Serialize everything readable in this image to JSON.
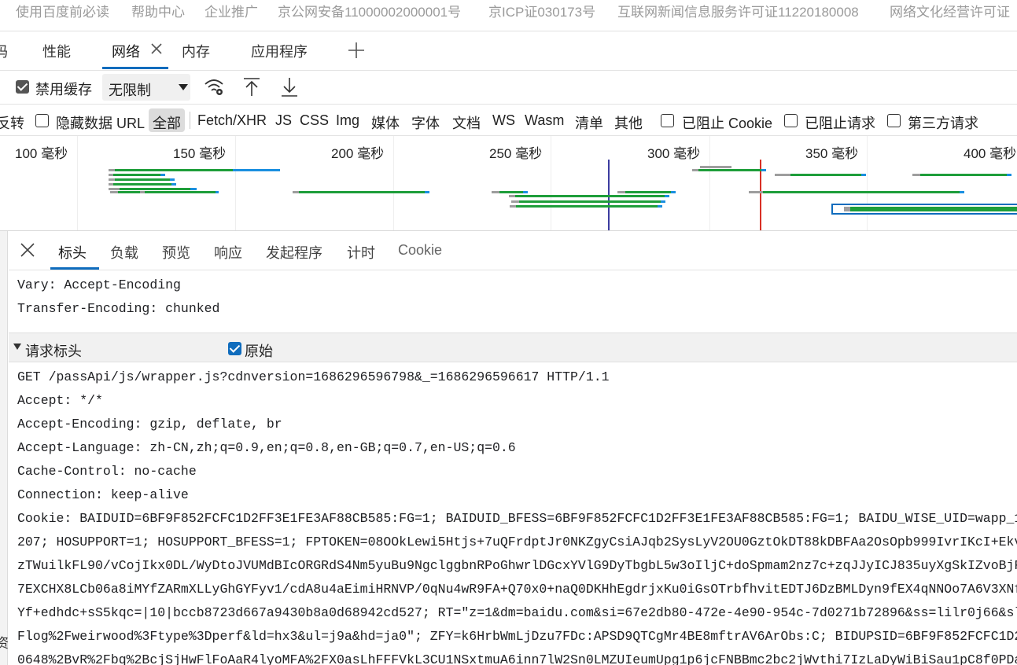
{
  "page_footer": {
    "links": [
      "使用百度前必读",
      "帮助中心",
      "企业推广",
      "京公网安备11000002000001号",
      "京ICP证030173号",
      "互联网新闻信息服务许可证11220180008",
      "网络文化经营许可证"
    ]
  },
  "tabs": {
    "items": [
      "码",
      "性能",
      "网络",
      "内存",
      "应用程序"
    ],
    "active": "网络"
  },
  "toolbar": {
    "disable_cache_label": "禁用缓存",
    "disable_cache_checked": true,
    "throttle_value": "无限制"
  },
  "filters": {
    "invert_label": "反转",
    "hide_data_urls_label": "隐藏数据 URL",
    "types": [
      "全部",
      "Fetch/XHR",
      "JS",
      "CSS",
      "Img",
      "媒体",
      "字体",
      "文档",
      "WS",
      "Wasm",
      "清单",
      "其他"
    ],
    "blocked_cookies_label": "已阻止 Cookie",
    "blocked_requests_label": "已阻止请求",
    "third_party_label": "第三方请求"
  },
  "timeline": {
    "labels": [
      "100  毫秒",
      "150  毫秒",
      "200  毫秒",
      "250  毫秒",
      "300  毫秒",
      "350  毫秒",
      "400  毫秒"
    ]
  },
  "detail": {
    "tabs": [
      "标头",
      "负载",
      "预览",
      "响应",
      "发起程序",
      "计时",
      "Cookie"
    ],
    "active": "标头",
    "response_headers": [
      "Vary: Accept-Encoding",
      "Transfer-Encoding: chunked"
    ],
    "request_section_title": "请求标头",
    "raw_label": "原始",
    "raw_checked": true,
    "request_lines": [
      "GET /passApi/js/wrapper.js?cdnversion=1686296596798&_=1686296596617 HTTP/1.1",
      "Accept: */*",
      "Accept-Encoding: gzip, deflate, br",
      "Accept-Language: zh-CN,zh;q=0.9,en;q=0.8,en-GB;q=0.7,en-US;q=0.6",
      "Cache-Control: no-cache",
      "Connection: keep-alive"
    ],
    "cookie_lines": [
      "Cookie: BAIDUID=6BF9F852FCFC1D2FF3E1FE3AF88CB585:FG=1; BAIDUID_BFESS=6BF9F852FCFC1D2FF3E1FE3AF88CB585:FG=1; BAIDU_WISE_UID=wapp_1",
      "207; HOSUPPORT=1; HOSUPPORT_BFESS=1; FPTOKEN=08OOkLewi5Htjs+7uQFrdptJr0NKZgyCsiAJqb2SysLyV2OU0GztOkDT88kDBFAa2OsOpb999IvrIKcI+Ekv",
      "zTWuilkFL90/vCojIkx0DL/WyDtoJVUMdBIcORGRdS4Nm5yuBu9NgclggbnRPoGhwrlDGcxYVlG9DyTbgbL5w3oIljC+doSpmam2nz7c+zqJJyICJ835uyXgSkIZvoBjF",
      "7EXCHX8LCb06a8iMYfZARmXLLyGhGYFyv1/cdA8u4aEimiHRNVP/0qNu4wR9FA+Q70x0+naQ0DKHhEgdrjxKu0iGsOTrbfhvitEDTJ6DzBMLDyn9fEX4qNNOo7A6V3XNf",
      "Yf+edhdc+sS5kqc=|10|bccb8723d667a9430b8a0d68942cd527; RT=\"z=1&dm=baidu.com&si=67e2db80-472e-4e90-954c-7d0271b72896&ss=lilr0j66&sl",
      "Flog%2Fweirwood%3Ftype%3Dperf&ld=hx3&ul=j9a&hd=ja0\"; ZFY=k6HrbWmLjDzu7FDc:APSD9QTCgMr4BE8mftrAV6ArObs:C; BIDUPSID=6BF9F852FCFC1D2",
      "0648%2BvR%2Fbq%2BcjSjHwFlFoAaR4lyoMFA%2FX0asLhFFFVkL3CU1NSxtmuA6inn7lW2Sn0LMZUIeumUpg1p6jcFNBBmc2bc2jWvthi7IzLaDyWiBiSau1pC8f0PDa"
    ],
    "gutter_glyph": "资"
  },
  "colors": {
    "accent": "#0f6cbd",
    "waterfall_green": "#1e9e3a",
    "waterfall_blue": "#1a8fe0",
    "waterfall_gray": "#9e9e9e",
    "dom_content_loaded": "#3c3ca0",
    "load_event": "#d93025"
  }
}
